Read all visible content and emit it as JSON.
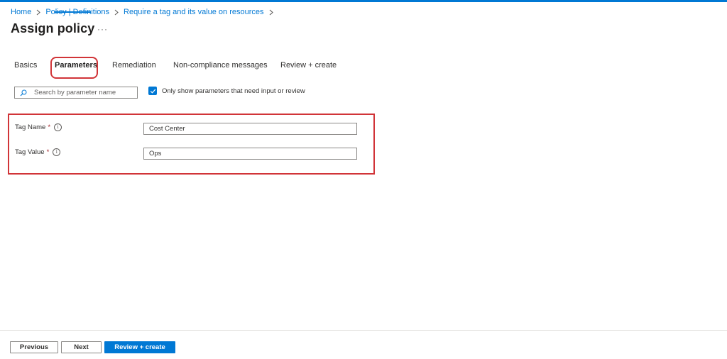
{
  "breadcrumb": {
    "items": [
      "Home",
      "Policy | Definitions",
      "Require a tag and its value on resources"
    ]
  },
  "page": {
    "title": "Assign policy",
    "more": "···"
  },
  "tabs": [
    {
      "label": "Basics",
      "active": false
    },
    {
      "label": "Parameters",
      "active": true
    },
    {
      "label": "Remediation",
      "active": false
    },
    {
      "label": "Non-compliance messages",
      "active": false
    },
    {
      "label": "Review + create",
      "active": false
    }
  ],
  "search": {
    "placeholder": "Search by parameter name",
    "value": ""
  },
  "filter": {
    "label": "Only show parameters that need input or review",
    "checked": true
  },
  "parameters": [
    {
      "label": "Tag Name",
      "required": "*",
      "value": "Cost Center"
    },
    {
      "label": "Tag Value",
      "required": "*",
      "value": "Ops"
    }
  ],
  "footer": {
    "previous_label": "Previous",
    "next_label": "Next",
    "review_label": "Review + create"
  },
  "colors": {
    "accent": "#0078d4",
    "highlight": "#d13438"
  }
}
